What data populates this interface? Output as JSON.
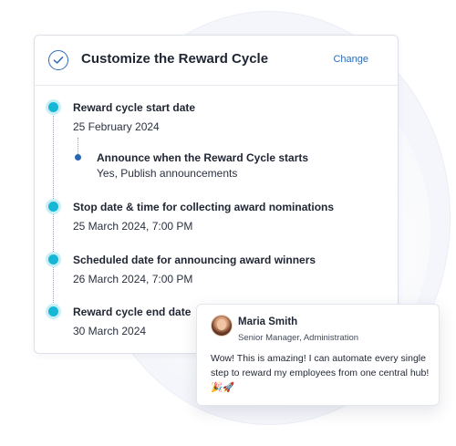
{
  "card": {
    "title": "Customize the Reward Cycle",
    "change_label": "Change",
    "check_icon": "check-circle-icon",
    "accent_color": "#16b7d6"
  },
  "timeline": {
    "items": [
      {
        "title": "Reward cycle start date",
        "value": "25 February 2024"
      },
      {
        "title": "Announce when the Reward Cycle starts",
        "value": "Yes, Publish announcements"
      },
      {
        "title": "Stop date & time for collecting award nominations",
        "value": "25 March 2024, 7:00 PM"
      },
      {
        "title": "Scheduled date for announcing award winners",
        "value": "26 March 2024, 7:00 PM"
      },
      {
        "title": "Reward cycle end date",
        "value": "30 March 2024"
      }
    ]
  },
  "comment": {
    "name": "Maria Smith",
    "role": "Senior Manager, Administration",
    "text": "Wow! This is amazing! I can automate every single step to reward my employees from one central hub! 🎉🚀"
  }
}
